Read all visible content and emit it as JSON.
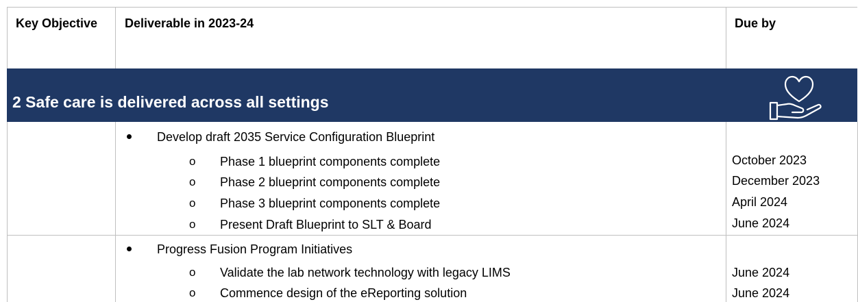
{
  "table": {
    "headers": {
      "objective": "Key Objective",
      "deliverable": "Deliverable in 2023-24",
      "due": "Due by"
    },
    "section": {
      "title": "2 Safe care is delivered across all settings",
      "icon": "heart-hand-icon",
      "color": "#1f3864"
    },
    "rows": [
      {
        "bullet": "Develop draft 2035 Service Configuration Blueprint",
        "sub_marker": "o",
        "items": [
          {
            "text": "Phase 1 blueprint components complete",
            "due": "October 2023"
          },
          {
            "text": "Phase 2 blueprint components complete",
            "due": "December 2023"
          },
          {
            "text": "Phase 3 blueprint components complete",
            "due": "April 2024"
          },
          {
            "text": "Present Draft Blueprint to SLT & Board",
            "due": "June 2024"
          }
        ]
      },
      {
        "bullet": "Progress Fusion Program Initiatives",
        "sub_marker": "o",
        "items": [
          {
            "text": "Validate the lab network technology with legacy LIMS",
            "due": "June 2024"
          },
          {
            "text": "Commence design of the eReporting solution",
            "due": "June 2024"
          }
        ]
      }
    ]
  }
}
